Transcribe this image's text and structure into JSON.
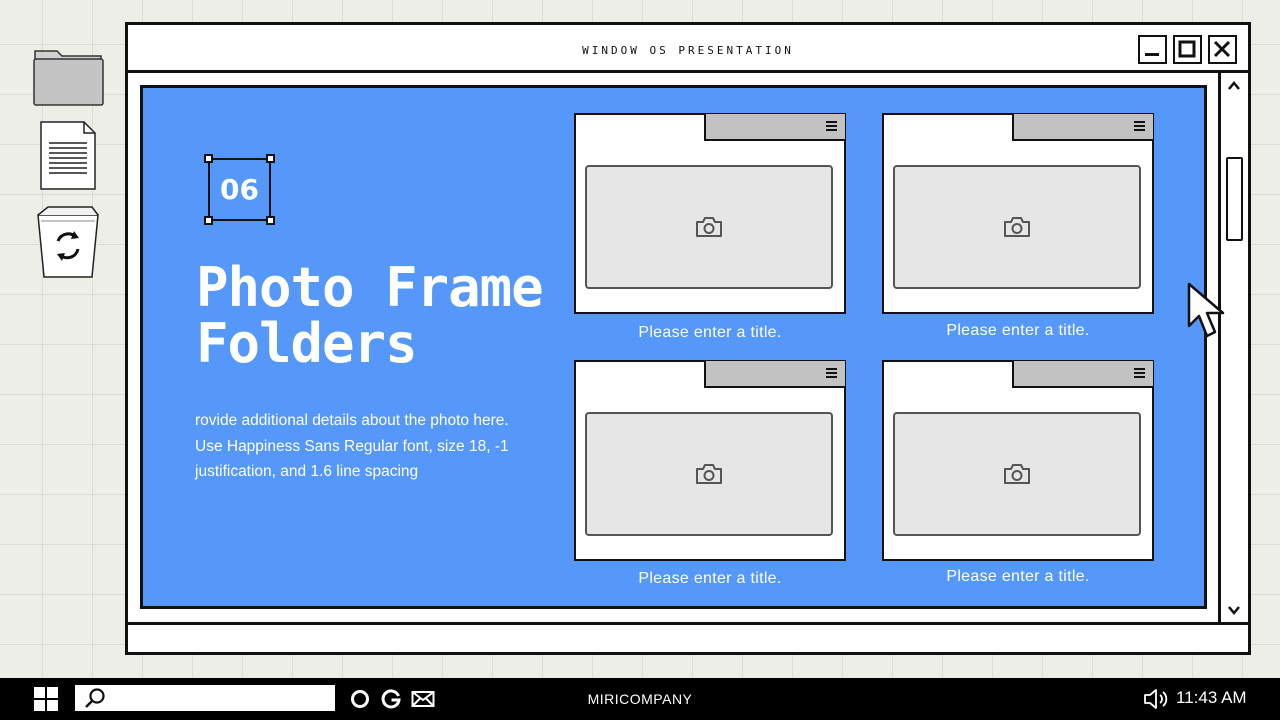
{
  "desktop": {
    "icons": [
      {
        "name": "folder-icon"
      },
      {
        "name": "document-icon"
      },
      {
        "name": "recycle-bin-icon"
      }
    ]
  },
  "window": {
    "title": "WINDOW OS PRESENTATION",
    "controls": [
      "minimize",
      "maximize",
      "close"
    ]
  },
  "slide": {
    "number": "06",
    "title_line1": "Photo Frame",
    "title_line2": "Folders",
    "description": "rovide additional details about the photo here. Use Happiness Sans Regular font, size 18, -1 justification, and 1.6 line spacing"
  },
  "frames": [
    {
      "caption": "Please enter a title."
    },
    {
      "caption": "Please enter a title."
    },
    {
      "caption": "Please enter a title."
    },
    {
      "caption": "Please enter a title."
    }
  ],
  "taskbar": {
    "search_placeholder": "",
    "center_label": "MIRICOMPANY",
    "time": "11:43 AM"
  },
  "colors": {
    "content_bg": "#5598f9",
    "frame_tab": "#c2c2c2",
    "photo_slot": "#e6e6e6",
    "taskbar": "#000000"
  }
}
